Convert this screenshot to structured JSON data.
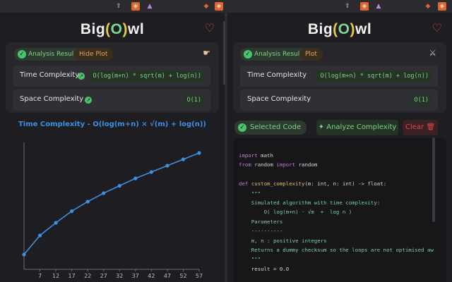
{
  "brand": {
    "prefix": "Big",
    "open": "(",
    "o": "O",
    "close": ")",
    "suffix": "wl"
  },
  "left": {
    "analysis_label": "Analysis Result",
    "toggle_label": "Hide Plot",
    "time_label": "Time Complexity",
    "time_value": "O(log(m+n) * sqrt(m) + log(n))",
    "space_label": "Space Complexity",
    "space_value": "O(1)"
  },
  "right": {
    "analysis_label": "Analysis Result",
    "toggle_label": "Plot",
    "time_label": "Time Complexity",
    "time_value": "O(log(m+n) * sqrt(m) + log(n))",
    "space_label": "Space Complexity",
    "space_value": "O(1)",
    "selected_label": "Selected Code",
    "analyze_label": "Analyze Complexity",
    "clear_label": "Clear"
  },
  "chart_data": {
    "type": "line",
    "title": "Time Complexity - O(log(m+n) × √(m) + log(n))",
    "x": [
      2,
      7,
      12,
      17,
      22,
      27,
      32,
      37,
      42,
      47,
      52,
      57
    ],
    "y": [
      1.7,
      2.6,
      3.2,
      3.75,
      4.2,
      4.6,
      4.95,
      5.3,
      5.6,
      5.9,
      6.2,
      6.5
    ],
    "tick_labels": [
      "7",
      "12",
      "17",
      "22",
      "27",
      "32",
      "37",
      "42",
      "47",
      "52",
      "57"
    ],
    "xlim": [
      2,
      57
    ],
    "ylim": [
      1,
      7
    ],
    "color": "#3d8fe0"
  },
  "code_lines": [
    "import math",
    "from random import random",
    "",
    "def custom_complexity(m: int, n: int) -> float:",
    "    \"\"\"",
    "    Simulated algorithm with time complexity:",
    "        O( log(m+n) · √m  +  log n )",
    "",
    "    Parameters",
    "    ----------",
    "    m, n : positive integers",
    "    Returns a dummy checksum so the loops are not optimised aw",
    "    \"\"\"",
    "    result = 0.0"
  ],
  "colors": {
    "accent_green": "#7ed28d",
    "accent_orange": "#e3a45b",
    "accent_blue": "#3d8fe0",
    "danger": "#e0454f"
  }
}
